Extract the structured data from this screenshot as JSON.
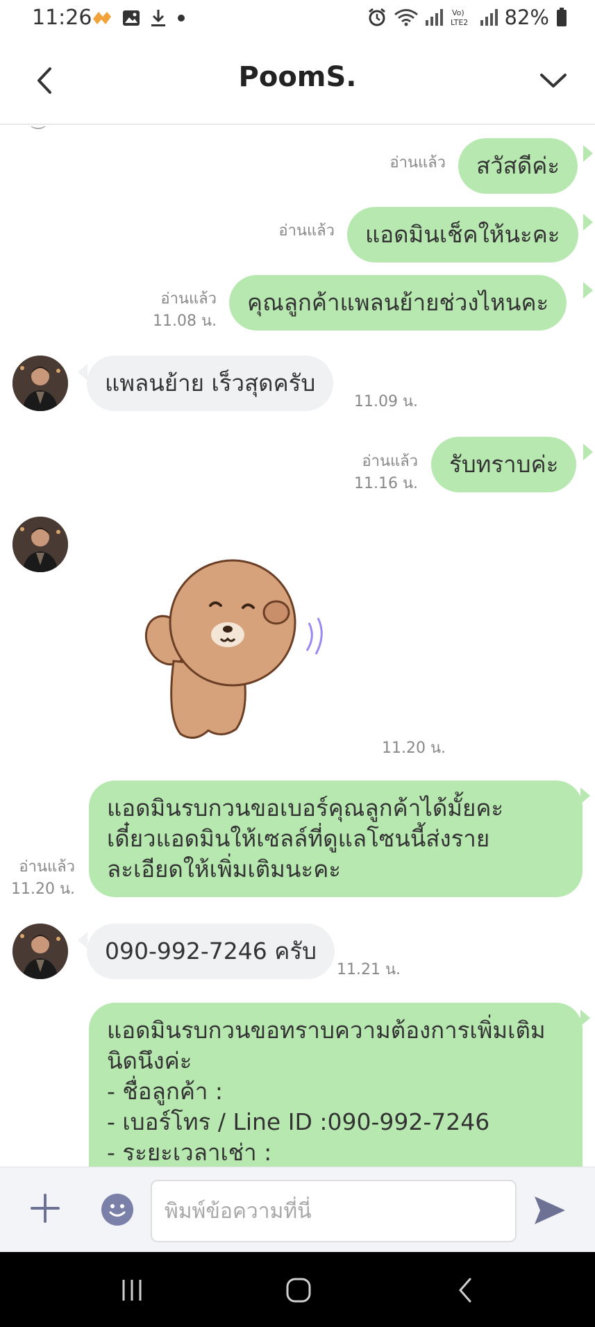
{
  "status_bar": {
    "time": "11:26",
    "battery": "82%",
    "icons": [
      "notification-app-icon",
      "gallery-icon",
      "download-icon",
      "dot-icon",
      "alarm-icon",
      "wifi-icon",
      "signal-icon",
      "volte-icon",
      "signal-icon",
      "battery-icon"
    ]
  },
  "header": {
    "title": "PoomS.",
    "back_icon": "chevron-left-icon",
    "menu_icon": "chevron-down-icon"
  },
  "messages": [
    {
      "sender": "me",
      "text": "สวัสดีค่ะ",
      "read": "อ่านแล้ว",
      "time": ""
    },
    {
      "sender": "me",
      "text": "แอดมินเช็คให้นะคะ",
      "read": "อ่านแล้ว",
      "time": ""
    },
    {
      "sender": "me",
      "text": "คุณลูกค้าแพลนย้ายช่วงไหนคะ",
      "read": "อ่านแล้ว",
      "time": "11.08 น."
    },
    {
      "sender": "them",
      "text": "แพลนย้าย เร็วสุดครับ",
      "time": "11.09 น."
    },
    {
      "sender": "me",
      "text": "รับทราบค่ะ",
      "read": "อ่านแล้ว",
      "time": "11.16 น."
    },
    {
      "sender": "them",
      "type": "sticker",
      "sticker": "bear-sticker",
      "time": "11.20 น."
    },
    {
      "sender": "me",
      "lines": [
        "แอดมินรบกวนขอเบอร์คุณลูกค้าได้มั้ยคะ",
        "เดี๋ยวแอดมินให้เซลล์ที่ดูแลโซนนี้ส่งราย",
        "ละเอียดให้เพิ่มเติมนะคะ"
      ],
      "read": "อ่านแล้ว",
      "time": "11.20 น."
    },
    {
      "sender": "them",
      "text": "090-992-7246 ครับ",
      "time": "11.21 น."
    },
    {
      "sender": "me",
      "lines": [
        "แอดมินรบกวนขอทราบความต้องการเพิ่มเติม",
        "นิดนึงค่ะ",
        "- ชื่อลูกค้า :",
        "- เบอร์โทร / Line ID :090-992-7246",
        "- ระยะเวลาเช่า :"
      ]
    }
  ],
  "composer": {
    "placeholder": "พิมพ์ข้อความที่นี่",
    "value": "",
    "plus_icon": "plus-icon",
    "emoji_icon": "emoji-icon",
    "send_icon": "send-icon"
  },
  "nav_bar": {
    "buttons": [
      "recent-apps-icon",
      "home-icon",
      "back-icon"
    ]
  }
}
